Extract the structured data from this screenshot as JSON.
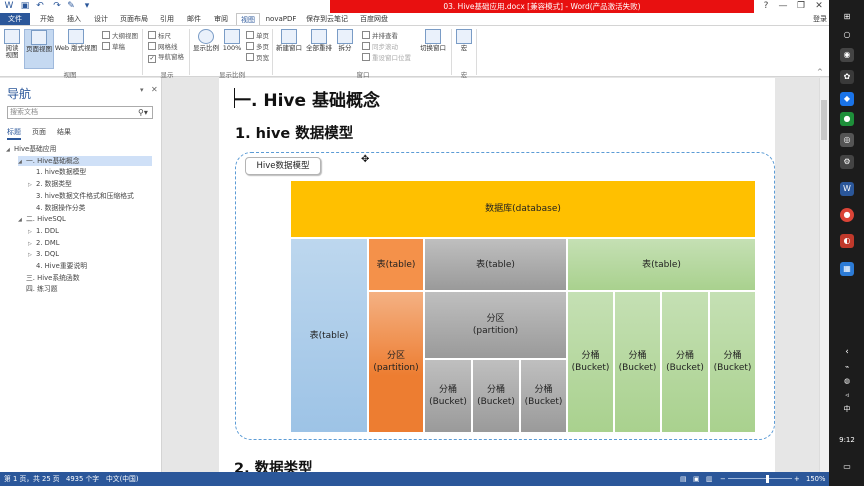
{
  "window": {
    "title": "03. Hive基础应用.docx [兼容模式] - Word(产品激活失败)",
    "login": "登录",
    "controls": [
      "?",
      "—",
      "❐",
      "✕"
    ]
  },
  "tabs": [
    "文件",
    "开始",
    "插入",
    "设计",
    "页面布局",
    "引用",
    "邮件",
    "审阅",
    "视图",
    "novaPDF",
    "保存到云笔记",
    "百度网盘"
  ],
  "ribbon": {
    "view_buttons": [
      "阅读视图",
      "页面视图",
      "Web 版式视图"
    ],
    "view_small": [
      "大纲视图",
      "草稿"
    ],
    "view_group": "视图",
    "show_checks": [
      "标尺",
      "网格线",
      "导航窗格"
    ],
    "show_group": "显示",
    "zoom_buttons": [
      "显示比例",
      "100%"
    ],
    "zoom_small": [
      "单页",
      "多页",
      "页宽"
    ],
    "zoom_group": "显示比例",
    "window_buttons": [
      "新建窗口",
      "全部重排",
      "拆分"
    ],
    "window_small": [
      "并排查看",
      "同步滚动",
      "重设窗口位置"
    ],
    "switch_button": "切换窗口",
    "window_group": "窗口",
    "macro_button": "宏",
    "macro_group": "宏"
  },
  "nav": {
    "title": "导航",
    "search_placeholder": "搜索文档",
    "tabs": [
      "标题",
      "页面",
      "结果"
    ],
    "tree": [
      {
        "label": "Hive基础应用",
        "level": 0,
        "arrow": "◢"
      },
      {
        "label": "一. Hive基础概念",
        "level": 1,
        "arrow": "◢",
        "selected": true
      },
      {
        "label": "1. hive数据模型",
        "level": 2,
        "arrow": ""
      },
      {
        "label": "2. 数据类型",
        "level": 2,
        "arrow": "▷"
      },
      {
        "label": "3. hive数据文件格式和压缩格式",
        "level": 2,
        "arrow": ""
      },
      {
        "label": "4. 数据操作分类",
        "level": 2,
        "arrow": ""
      },
      {
        "label": "二. HiveSQL",
        "level": 1,
        "arrow": "◢"
      },
      {
        "label": "1. DDL",
        "level": 2,
        "arrow": "▷"
      },
      {
        "label": "2. DML",
        "level": 2,
        "arrow": "▷"
      },
      {
        "label": "3. DQL",
        "level": 2,
        "arrow": "▷"
      },
      {
        "label": "4. Hive重要说明",
        "level": 2,
        "arrow": ""
      },
      {
        "label": "三. Hive系统函数",
        "level": 1,
        "arrow": ""
      },
      {
        "label": "四. 练习题",
        "level": 1,
        "arrow": ""
      }
    ]
  },
  "document": {
    "heading1": "一. Hive 基础概念",
    "heading2": "1. hive 数据模型",
    "heading3": "2. 数据类型",
    "frame_label": "Hive数据模型",
    "diagram": {
      "database": "数据库(database)",
      "table_main": "表(table)",
      "table_orange": "表(table)",
      "partition_orange": "分区\n(partition)",
      "table_gray": "表(table)",
      "partition_gray": "分区\n(partition)",
      "bucket_gray": [
        "分桶\n(Bucket)",
        "分桶\n(Bucket)",
        "分桶\n(Bucket)"
      ],
      "table_green": "表(table)",
      "bucket_green": [
        "分桶\n(Bucket)",
        "分桶\n(Bucket)",
        "分桶\n(Bucket)",
        "分桶\n(Bucket)"
      ]
    }
  },
  "status": {
    "page": "第 1 页，共 25 页",
    "words": "4935 个字",
    "lang": "中文(中国)",
    "zoom": "150%"
  },
  "taskbar": {
    "time": "9:12",
    "ime": "中"
  }
}
